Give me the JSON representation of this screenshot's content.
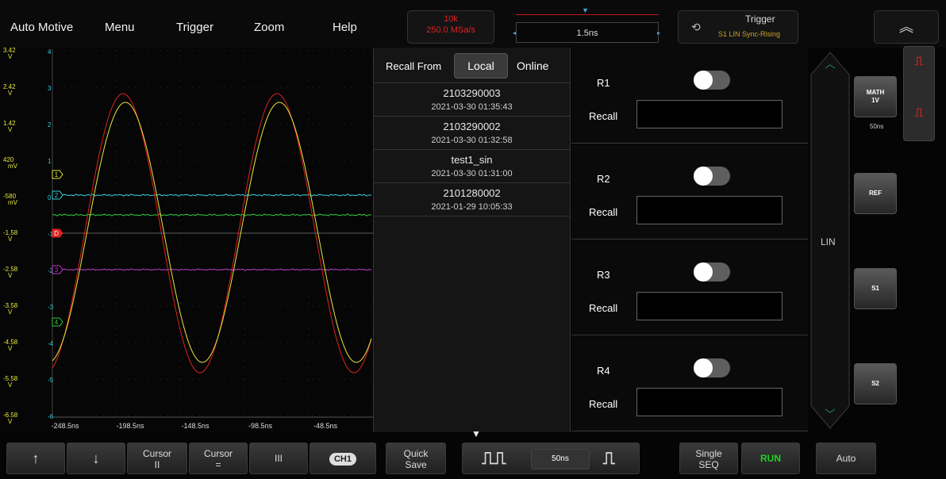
{
  "menu": {
    "items": [
      "Auto Motive",
      "Menu",
      "Trigger",
      "Zoom",
      "Help"
    ]
  },
  "acquisition": {
    "points": "10k",
    "rate": "250.0 MSa/s"
  },
  "trigger_time": "1.5ns",
  "trigger": {
    "title": "Trigger",
    "detail": "S1 LIN Sync-Rising"
  },
  "icons": {
    "collapse": "double-chevron-up-icon",
    "trigger_edge": "trigger-edge-icon",
    "up": "up-arrow-icon",
    "down": "down-arrow-icon",
    "pulse_train": "pulse-train-icon",
    "pulse": "pulse-icon"
  },
  "scope": {
    "voltage_labels": [
      {
        "v": "3.42",
        "u": "V",
        "ch": "4"
      },
      {
        "v": "2.42",
        "u": "V",
        "ch": "3"
      },
      {
        "v": "1.42",
        "u": "V",
        "ch": "2"
      },
      {
        "v": "420",
        "u": "mV",
        "ch": "1"
      },
      {
        "v": "-580",
        "u": "mV",
        "ch": "0"
      },
      {
        "v": "-1.58",
        "u": "V",
        "ch": "-1"
      },
      {
        "v": "-2.58",
        "u": "V",
        "ch": "-2"
      },
      {
        "v": "-3.58",
        "u": "V",
        "ch": "-3"
      },
      {
        "v": "-4.58",
        "u": "V",
        "ch": "-4"
      },
      {
        "v": "-5.58",
        "u": "V",
        "ch": "-5"
      },
      {
        "v": "-6.58",
        "u": "V",
        "ch": "-6"
      }
    ],
    "time_labels": [
      "-248.5ns",
      "-198.5ns",
      "-148.5ns",
      "-98.5ns",
      "-48.5ns"
    ],
    "channel_markers": [
      "1",
      "2",
      "D",
      "3",
      "4"
    ],
    "colors": {
      "ch1": "#e8e83a",
      "ch2": "#3ad0e0",
      "ref": "#e02020",
      "ch3": "#c040d0",
      "ch4": "#30d040"
    }
  },
  "recall_list": {
    "label": "Recall From",
    "tab_local": "Local",
    "tab_online": "Online",
    "items": [
      {
        "name": "2103290003",
        "date": "2021-03-30 01:35:43"
      },
      {
        "name": "2103290002",
        "date": "2021-03-30 01:32:58"
      },
      {
        "name": "test1_sin",
        "date": "2021-03-30 01:31:00"
      },
      {
        "name": "2101280002",
        "date": "2021-01-29 10:05:33"
      }
    ]
  },
  "slots": [
    {
      "name": "R1",
      "recall_label": "Recall",
      "enabled": false
    },
    {
      "name": "R2",
      "recall_label": "Recall",
      "enabled": false
    },
    {
      "name": "R3",
      "recall_label": "Recall",
      "enabled": false
    },
    {
      "name": "R4",
      "recall_label": "Recall",
      "enabled": false
    }
  ],
  "lin_label": "LIN",
  "right_buttons": {
    "math_line1": "MATH",
    "math_line2": "1V",
    "math_sub": "50ns",
    "ref": "REF",
    "s1": "S1",
    "s2": "S2"
  },
  "bottom": {
    "cursor1_line1": "Cursor",
    "cursor1_line2": "II",
    "cursor2_line1": "Cursor",
    "cursor2_line2": "=",
    "cursor3": "III",
    "ch1": "CH1",
    "quick_save_1": "Quick",
    "quick_save_2": "Save",
    "timebase": "50ns",
    "single_1": "Single",
    "single_2": "SEQ",
    "run": "RUN",
    "auto": "Auto"
  }
}
